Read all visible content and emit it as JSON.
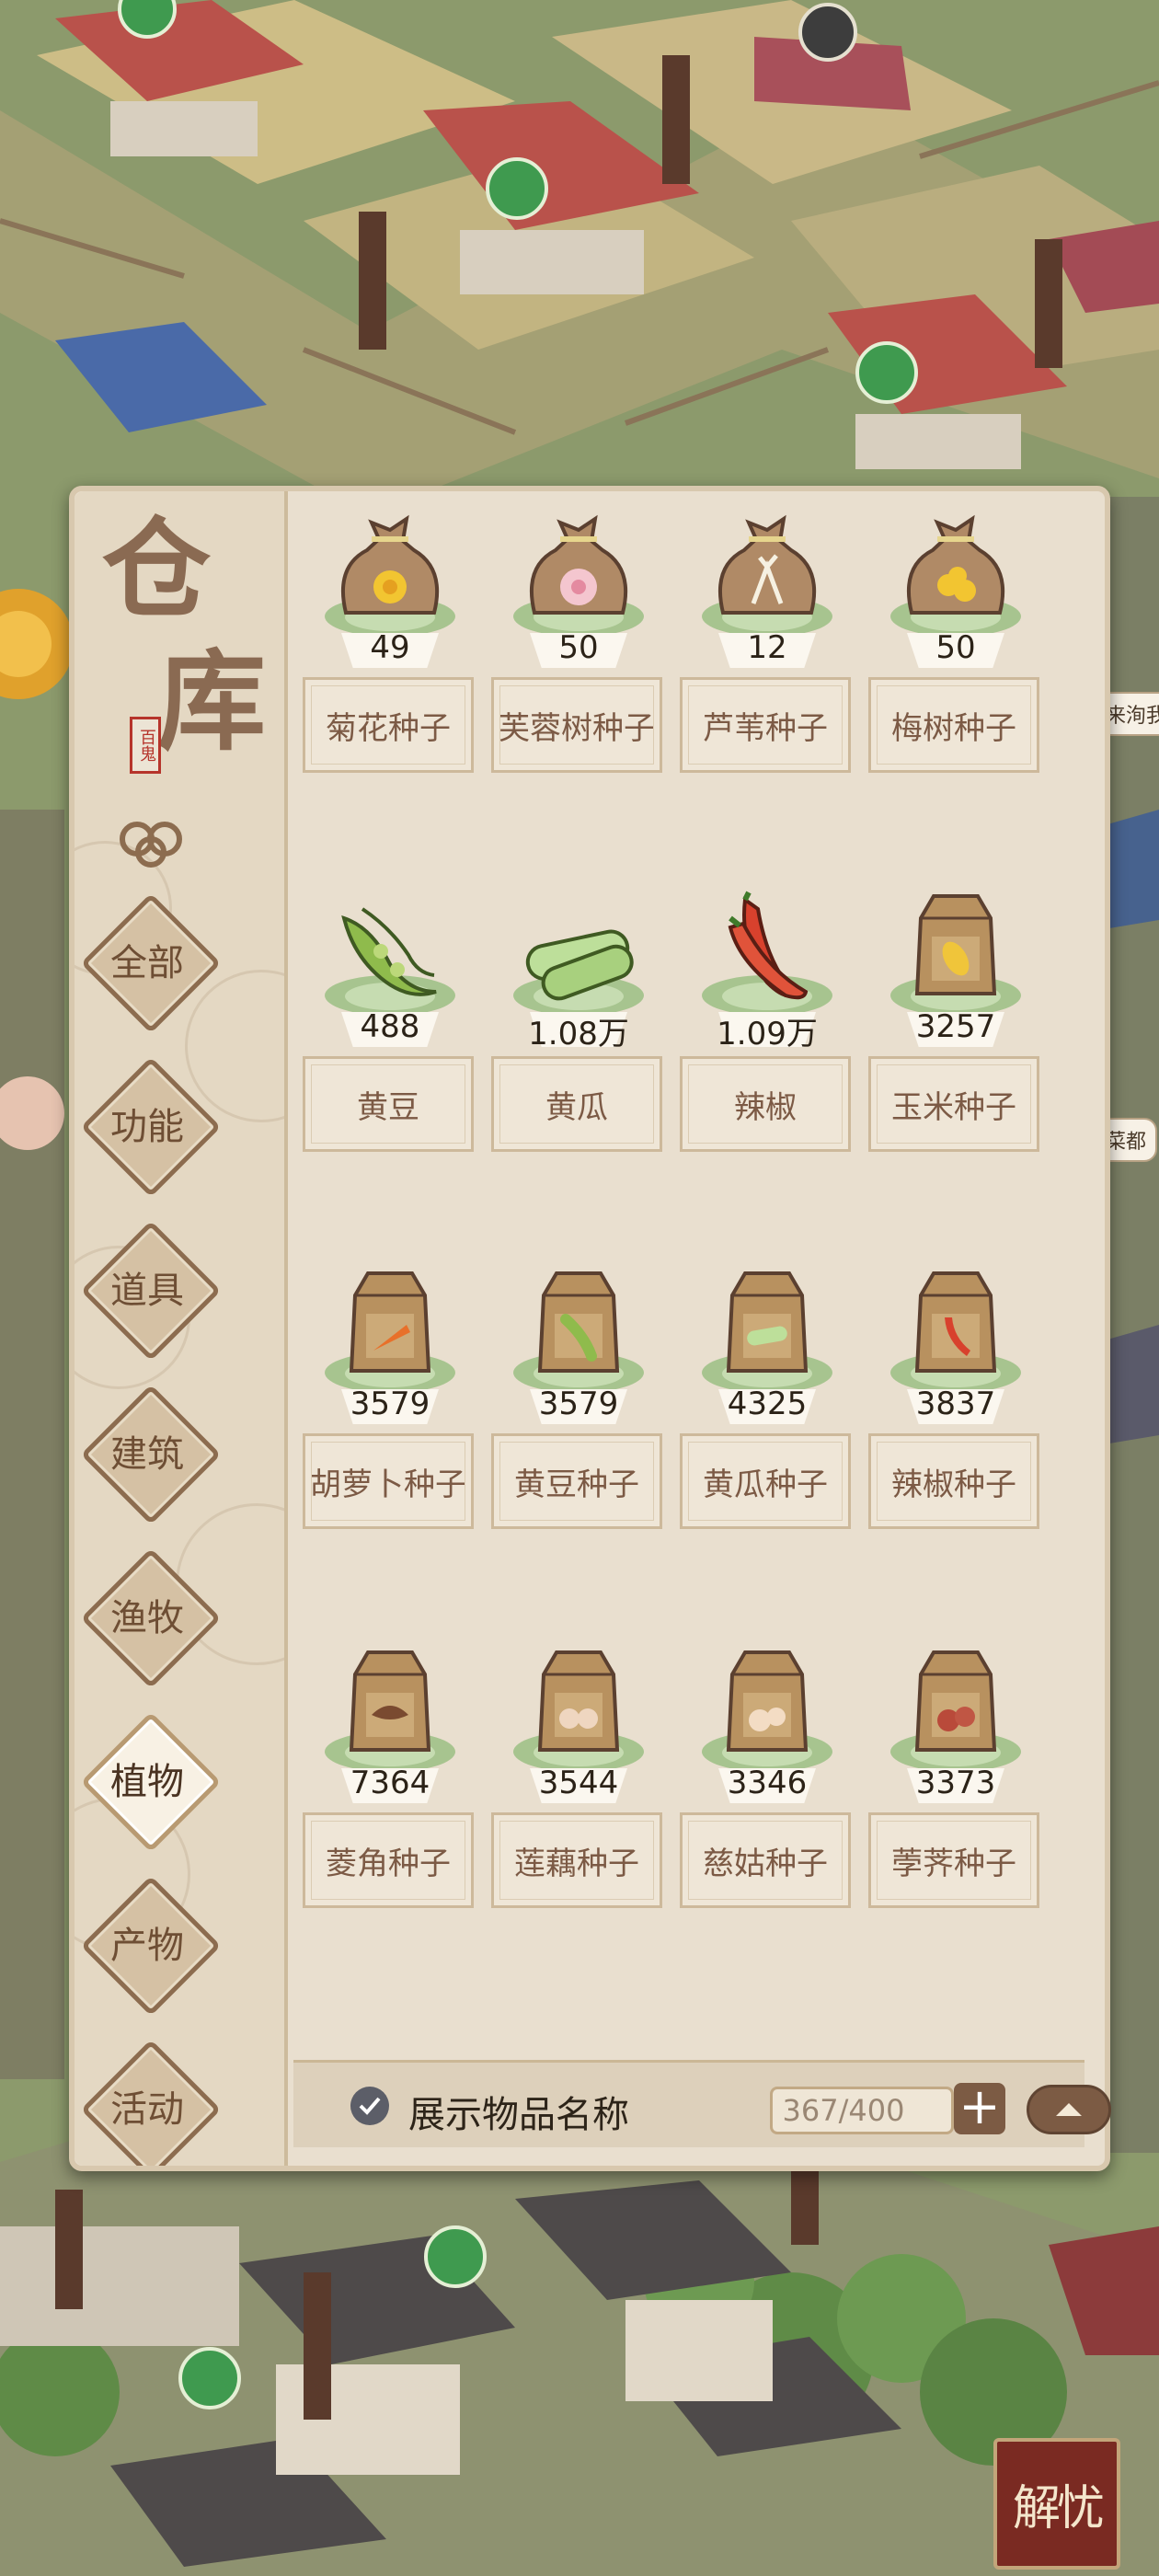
{
  "panel": {
    "title_chars": [
      "仓",
      "库"
    ],
    "seal_text": "百鬼"
  },
  "categories": [
    {
      "label": "全部",
      "active": false
    },
    {
      "label": "功能",
      "active": false
    },
    {
      "label": "道具",
      "active": false
    },
    {
      "label": "建筑",
      "active": false
    },
    {
      "label": "渔牧",
      "active": false
    },
    {
      "label": "植物",
      "active": true
    },
    {
      "label": "产物",
      "active": false
    },
    {
      "label": "活动",
      "active": false
    }
  ],
  "items": [
    {
      "name": "菊花种子",
      "count": "49",
      "icon": "seed-sack-chrysanthemum-icon"
    },
    {
      "name": "芙蓉树种子",
      "count": "50",
      "icon": "seed-sack-hibiscus-icon"
    },
    {
      "name": "芦苇种子",
      "count": "12",
      "icon": "seed-sack-reed-icon"
    },
    {
      "name": "梅树种子",
      "count": "50",
      "icon": "seed-sack-plum-icon"
    },
    {
      "name": "黄豆",
      "count": "488",
      "icon": "soybean-icon"
    },
    {
      "name": "黄瓜",
      "count": "1.08万",
      "icon": "cucumber-icon"
    },
    {
      "name": "辣椒",
      "count": "1.09万",
      "icon": "chili-pepper-icon"
    },
    {
      "name": "玉米种子",
      "count": "3257",
      "icon": "seed-bag-corn-icon"
    },
    {
      "name": "胡萝卜种子",
      "count": "3579",
      "icon": "seed-bag-carrot-icon"
    },
    {
      "name": "黄豆种子",
      "count": "3579",
      "icon": "seed-bag-soybean-icon"
    },
    {
      "name": "黄瓜种子",
      "count": "4325",
      "icon": "seed-bag-cucumber-icon"
    },
    {
      "name": "辣椒种子",
      "count": "3837",
      "icon": "seed-bag-chili-icon"
    },
    {
      "name": "菱角种子",
      "count": "7364",
      "icon": "seed-bag-water-caltrop-icon"
    },
    {
      "name": "莲藕种子",
      "count": "3544",
      "icon": "seed-bag-lotus-root-icon"
    },
    {
      "name": "慈姑种子",
      "count": "3346",
      "icon": "seed-bag-arrowhead-icon"
    },
    {
      "name": "荸荠种子",
      "count": "3373",
      "icon": "seed-bag-water-chestnut-icon"
    }
  ],
  "footer": {
    "show_names_label": "展示物品名称",
    "show_names_checked": true,
    "capacity": "367/400"
  },
  "overlay": {
    "corner_badge": "解忧",
    "bubble_1": "来洵我",
    "bubble_2": "菜都"
  },
  "colors": {
    "panel_bg": "#e9dfcf",
    "accent_brown": "#7c5b44",
    "plate_green": "#a7c48f"
  }
}
